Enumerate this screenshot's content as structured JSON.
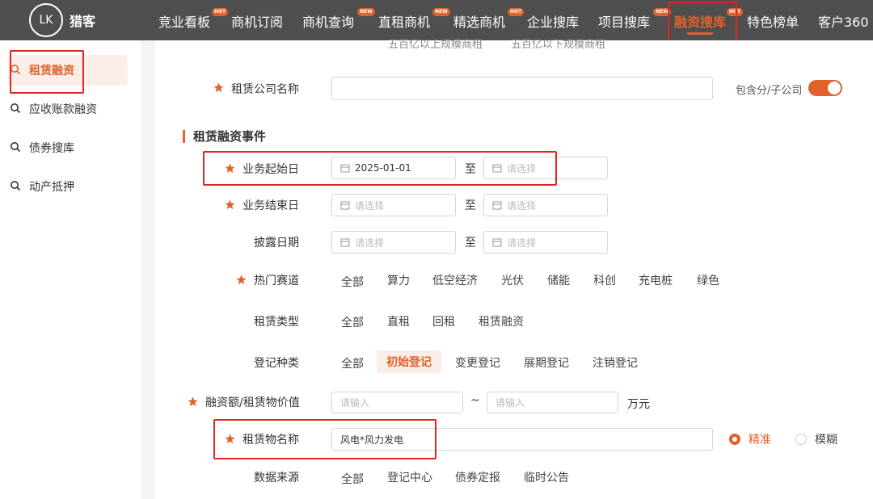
{
  "header": {
    "logo_text": "猎客",
    "logo_mark": "LK",
    "nav": [
      {
        "label": "竞业看板",
        "badge": "HOT"
      },
      {
        "label": "商机订阅",
        "badge": ""
      },
      {
        "label": "商机查询",
        "badge": "NEW"
      },
      {
        "label": "直租商机",
        "badge": "NEW"
      },
      {
        "label": "精选商机",
        "badge": "HOT"
      },
      {
        "label": "企业搜库",
        "badge": ""
      },
      {
        "label": "项目搜库",
        "badge": "NEW"
      },
      {
        "label": "融资搜库",
        "badge": "HOT"
      },
      {
        "label": "特色榜单",
        "badge": ""
      },
      {
        "label": "客户360",
        "badge": ""
      }
    ],
    "accent": "#e0622c"
  },
  "sidebar": {
    "items": [
      {
        "label": "租赁融资"
      },
      {
        "label": "应收账款融资"
      },
      {
        "label": "债券搜库"
      },
      {
        "label": "动产抵押"
      }
    ]
  },
  "form": {
    "top_faded": [
      "五百亿以上规模商租",
      "五百亿以下规模商租"
    ],
    "company_name_label": "租赁公司名称",
    "company_name_value": "",
    "include_sub_label": "包含分/子公司",
    "section_title": "租赁融资事件",
    "start_date_label": "业务起始日",
    "start_date_from": "2025-01-01",
    "start_date_to_placeholder": "请选择",
    "end_date_label": "业务结束日",
    "disclose_label": "披露日期",
    "date_placeholder": "请选择",
    "to_text": "至",
    "hot_track_label": "热门赛道",
    "hot_track_options": [
      "全部",
      "算力",
      "低空经济",
      "光伏",
      "储能",
      "科创",
      "充电桩",
      "绿色"
    ],
    "lease_type_label": "租赁类型",
    "lease_type_options": [
      "全部",
      "直租",
      "回租",
      "租赁融资"
    ],
    "reg_type_label": "登记种类",
    "reg_type_options": [
      "全部",
      "初始登记",
      "变更登记",
      "展期登记",
      "注销登记"
    ],
    "reg_type_selected": "初始登记",
    "amount_label": "融资额/租赁物价值",
    "amount_placeholder": "请输入",
    "amount_sep": "~",
    "amount_unit": "万元",
    "leased_item_label": "租赁物名称",
    "leased_item_value": "风电*风力发电",
    "match_exact": "精准",
    "match_fuzzy": "模糊",
    "data_source_label": "数据来源",
    "data_source_options": [
      "全部",
      "登记中心",
      "债券定报",
      "临时公告"
    ]
  }
}
